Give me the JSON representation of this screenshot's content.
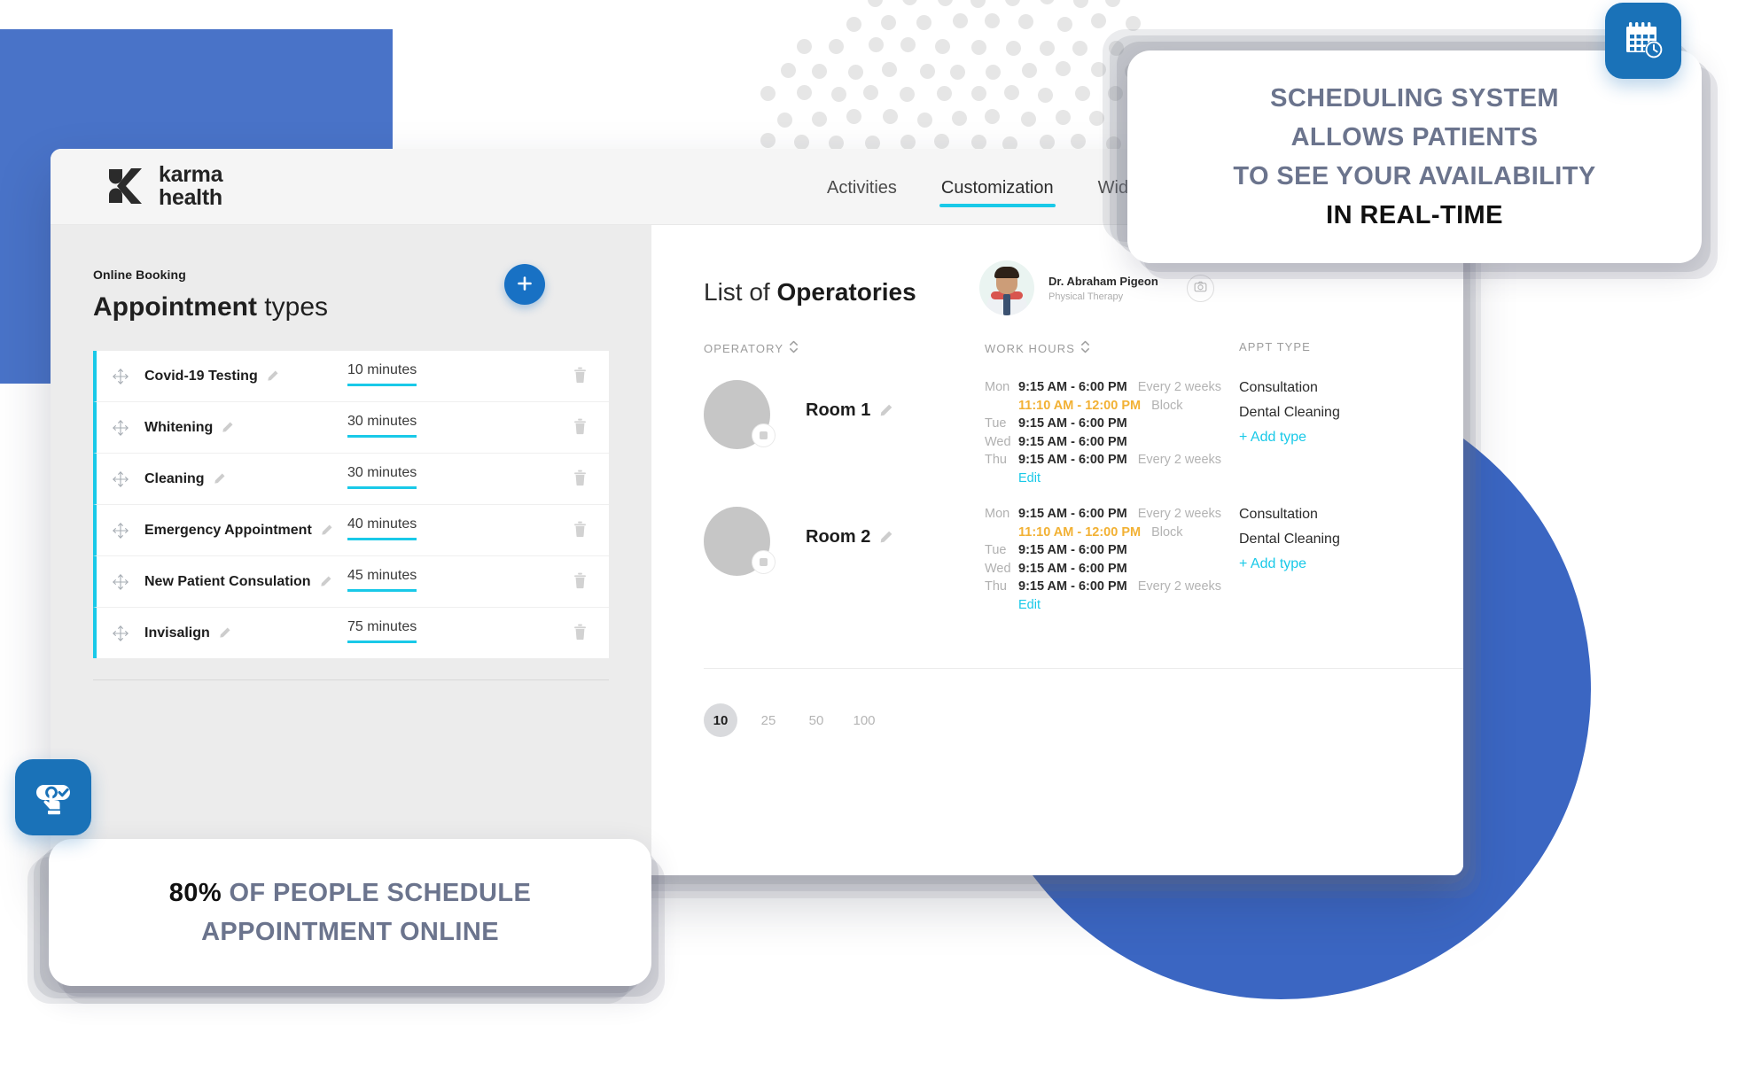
{
  "brand": {
    "name_line1": "karma",
    "name_line2": "health",
    "logo_icon": "karma-k-logo"
  },
  "nav": {
    "tabs": [
      {
        "label": "Activities",
        "active": false
      },
      {
        "label": "Customization",
        "active": true
      },
      {
        "label": "Widgets",
        "active": false
      }
    ]
  },
  "sidebar": {
    "kicker": "Online Booking",
    "title_bold": "Appointment",
    "title_light": " types",
    "add_button_label": "+",
    "add_button_icon": "plus-icon",
    "drag_icon": "drag-move-icon",
    "edit_icon": "pencil-icon",
    "delete_icon": "trash-icon",
    "appointment_types": [
      {
        "name": "Covid-19 Testing",
        "duration": "10 minutes"
      },
      {
        "name": "Whitening",
        "duration": "30 minutes"
      },
      {
        "name": "Cleaning",
        "duration": "30 minutes"
      },
      {
        "name": "Emergency Appointment",
        "duration": "40 minutes"
      },
      {
        "name": "New Patient Consulation",
        "duration": "45 minutes"
      },
      {
        "name": "Invisalign",
        "duration": "75 minutes"
      }
    ]
  },
  "content": {
    "title_light": "List of ",
    "title_bold": "Operatories",
    "doctor": {
      "name": "Dr. Abraham Pigeon",
      "role": "Physical Therapy",
      "avatar_icon": "doctor-avatar"
    },
    "camera_icon": "camera-icon",
    "columns": [
      {
        "label": "OPERATORY",
        "sort_icon": "sort-updown-icon"
      },
      {
        "label": "WORK HOURS",
        "sort_icon": "sort-updown-icon"
      },
      {
        "label": "APPT TYPE",
        "sort_icon": ""
      }
    ],
    "rows": [
      {
        "room": "Room 1",
        "edit_icon": "pencil-icon",
        "avatar_badge_icon": "image-placeholder-icon",
        "hours": [
          {
            "day": "Mon",
            "time": "9:15 AM - 6:00 PM",
            "note": "Every 2 weeks",
            "block": false
          },
          {
            "day": "",
            "time": "11:10 AM - 12:00 PM",
            "note": "Block",
            "block": true
          },
          {
            "day": "Tue",
            "time": "9:15 AM - 6:00 PM",
            "note": "",
            "block": false
          },
          {
            "day": "Wed",
            "time": "9:15 AM - 6:00 PM",
            "note": "",
            "block": false
          },
          {
            "day": "Thu",
            "time": "9:15 AM - 6:00 PM",
            "note": "Every 2 weeks",
            "block": false
          }
        ],
        "edit_label": "Edit",
        "appt_types": [
          "Consultation",
          "Dental Cleaning"
        ],
        "add_type_label": "+ Add type"
      },
      {
        "room": "Room 2",
        "edit_icon": "pencil-icon",
        "avatar_badge_icon": "image-placeholder-icon",
        "hours": [
          {
            "day": "Mon",
            "time": "9:15 AM - 6:00 PM",
            "note": "Every 2 weeks",
            "block": false
          },
          {
            "day": "",
            "time": "11:10 AM - 12:00 PM",
            "note": "Block",
            "block": true
          },
          {
            "day": "Tue",
            "time": "9:15 AM - 6:00 PM",
            "note": "",
            "block": false
          },
          {
            "day": "Wed",
            "time": "9:15 AM - 6:00 PM",
            "note": "",
            "block": false
          },
          {
            "day": "Thu",
            "time": "9:15 AM - 6:00 PM",
            "note": "Every 2 weeks",
            "block": false
          }
        ],
        "edit_label": "Edit",
        "appt_types": [
          "Consultation",
          "Dental Cleaning"
        ],
        "add_type_label": "+ Add type"
      }
    ],
    "pagination": [
      {
        "label": "10",
        "active": true
      },
      {
        "label": "25",
        "active": false
      },
      {
        "label": "50",
        "active": false
      },
      {
        "label": "100",
        "active": false
      }
    ]
  },
  "callouts": {
    "top": {
      "icon": "calendar-clock-icon",
      "lines": [
        {
          "text": "SCHEDULING SYSTEM",
          "emphasis": false
        },
        {
          "text": "ALLOWS PATIENTS",
          "emphasis": false
        },
        {
          "text": "TO SEE YOUR AVAILABILITY",
          "emphasis": false
        },
        {
          "text": "IN REAL-TIME",
          "emphasis": true
        }
      ]
    },
    "bottom": {
      "icon": "tap-confirm-icon",
      "stat": "80%",
      "lines": [
        {
          "text": " OF PEOPLE SCHEDULE",
          "emphasis": false
        },
        {
          "text": "APPOINTMENT ONLINE",
          "emphasis": false
        }
      ]
    }
  },
  "colors": {
    "accent_cyan": "#19c9e8",
    "brand_blue": "#1871c4",
    "deco_blue": "#3b66c2",
    "block_amber": "#f2b134",
    "callout_text": "#6b748d"
  }
}
